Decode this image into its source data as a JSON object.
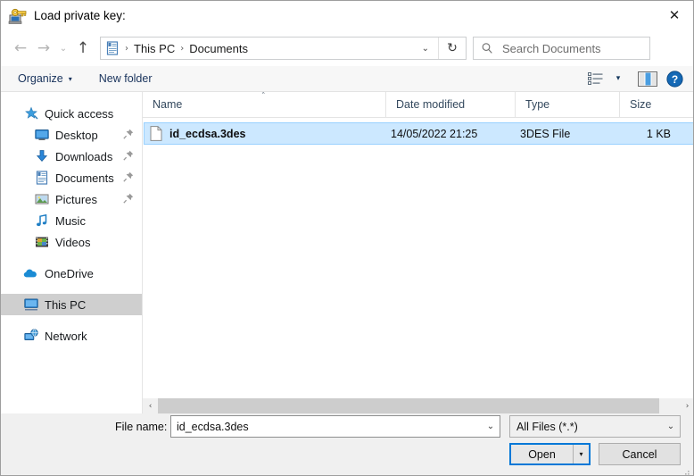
{
  "window": {
    "title": "Load private key:",
    "title_icon": "putty-key-icon",
    "close_label": "✕"
  },
  "nav": {
    "back_icon": "←",
    "forward_icon": "→",
    "history_icon": "⌄",
    "up_icon": "↑",
    "breadcrumb_icon": "documents-folder-icon",
    "breadcrumb": [
      "This PC",
      "Documents"
    ],
    "separator": "›",
    "dropdown_icon": "⌄",
    "refresh_icon": "↻"
  },
  "search": {
    "placeholder": "Search Documents",
    "icon": "search-icon"
  },
  "toolbar": {
    "organize_label": "Organize",
    "organize_caret": "▾",
    "new_folder_label": "New folder",
    "view_caret": "▾",
    "view_icon": "view-options-icon",
    "preview_icon": "preview-pane-icon",
    "help_icon": "help-icon",
    "help_label": "?"
  },
  "sidebar": {
    "items": [
      {
        "label": "Quick access",
        "icon": "quick-access-star-icon",
        "level": 0,
        "pinned": false,
        "selected": false
      },
      {
        "label": "Desktop",
        "icon": "desktop-icon",
        "level": 1,
        "pinned": true,
        "selected": false
      },
      {
        "label": "Downloads",
        "icon": "downloads-icon",
        "level": 1,
        "pinned": true,
        "selected": false
      },
      {
        "label": "Documents",
        "icon": "documents-icon",
        "level": 1,
        "pinned": true,
        "selected": false
      },
      {
        "label": "Pictures",
        "icon": "pictures-icon",
        "level": 1,
        "pinned": true,
        "selected": false
      },
      {
        "label": "Music",
        "icon": "music-icon",
        "level": 1,
        "pinned": false,
        "selected": false
      },
      {
        "label": "Videos",
        "icon": "videos-icon",
        "level": 1,
        "pinned": false,
        "selected": false
      },
      {
        "label": "OneDrive",
        "icon": "onedrive-cloud-icon",
        "level": 0,
        "pinned": false,
        "selected": false
      },
      {
        "label": "This PC",
        "icon": "this-pc-icon",
        "level": 0,
        "pinned": false,
        "selected": true
      },
      {
        "label": "Network",
        "icon": "network-icon",
        "level": 0,
        "pinned": false,
        "selected": false
      }
    ]
  },
  "file_list": {
    "columns": [
      {
        "key": "name",
        "label": "Name",
        "sorted": true,
        "sort_caret": "˄"
      },
      {
        "key": "date",
        "label": "Date modified",
        "sorted": false
      },
      {
        "key": "type",
        "label": "Type",
        "sorted": false
      },
      {
        "key": "size",
        "label": "Size",
        "sorted": false
      }
    ],
    "rows": [
      {
        "name": "id_ecdsa.3des",
        "date": "14/05/2022 21:25",
        "type": "3DES File",
        "size": "1 KB",
        "icon": "generic-file-icon",
        "selected": true
      }
    ],
    "scrollbar": {
      "left_arrow": "‹",
      "right_arrow": "›"
    }
  },
  "footer": {
    "file_name_label": "File name:",
    "file_name_value": "id_ecdsa.3des",
    "file_name_caret": "⌄",
    "file_type_value": "All Files (*.*)",
    "file_type_caret": "⌄",
    "open_label": "Open",
    "open_split_caret": "▾",
    "cancel_label": "Cancel"
  },
  "colors": {
    "accent": "#0078d7",
    "selection": "#cce8ff",
    "sidebar_selection": "#cfcfcf",
    "toolbar_text": "#19335c",
    "chrome": "#f0f0f0"
  }
}
